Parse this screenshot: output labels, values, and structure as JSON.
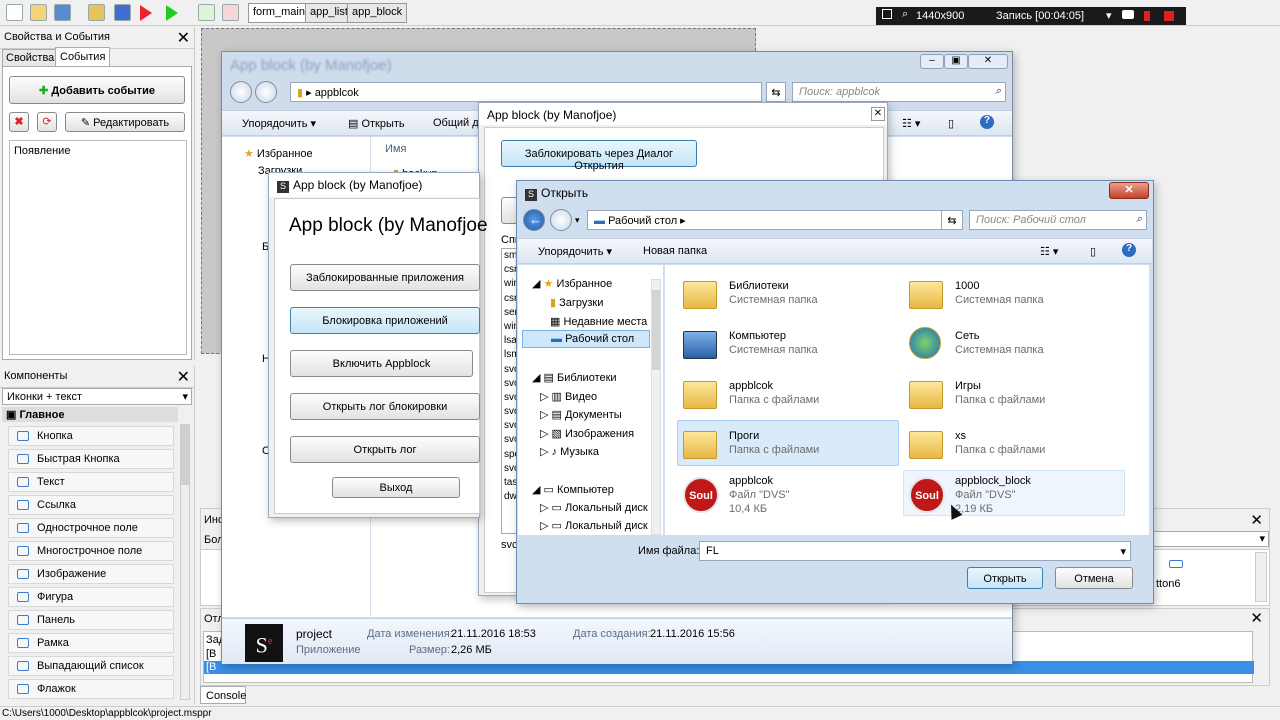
{
  "toolbar": {
    "tabs": [
      "form_main",
      "app_list",
      "app_block"
    ]
  },
  "recorder": {
    "resolution": "1440x900",
    "label": "Запись [00:04:05]"
  },
  "props": {
    "title": "Свойства и События",
    "tab_props": "Свойства",
    "tab_events": "События",
    "add_event": "Добавить событие",
    "edit": "Редактировать",
    "event_item": "Появление"
  },
  "components": {
    "title": "Компоненты",
    "view": "Иконки + текст",
    "group": "Главное",
    "items": [
      "Кнопка",
      "Быстрая Кнопка",
      "Текст",
      "Ссылка",
      "Однострочное поле",
      "Многострочное поле",
      "Изображение",
      "Фигура",
      "Панель",
      "Рамка",
      "Выпадающий список",
      "Флажок"
    ]
  },
  "statusbar": {
    "path": "C:\\Users\\1000\\Desktop\\appblcok\\project.msppr",
    "console_tab": "Console"
  },
  "bottom_panels": {
    "frag1": "Инс",
    "frag2": "Бол",
    "frag3": "Отл",
    "frag4": "Зад",
    "frag5": "[В",
    "frag6": "[В",
    "button6": "tton6"
  },
  "explorer_bg": {
    "title": "App block (by Manofjoe)",
    "address": "appblcok",
    "search": "Поиск: appblcok",
    "organize": "Упорядочить",
    "open": "Открыть",
    "share": "Общий д",
    "favorites": "Избранное",
    "downloads": "Загрузки",
    "name_col": "Имя",
    "file_name": "project",
    "file_type": "Приложение",
    "date_mod_label": "Дата изменения:",
    "date_mod": "21.11.2016 18:53",
    "date_created_label": "Дата создания:",
    "date_created": "21.11.2016 15:56",
    "size_label": "Размер:",
    "size": "2,26 МБ",
    "frag_b": "Б",
    "frag_n": "Н",
    "frag_s": "С",
    "frag_backup": "backup"
  },
  "app_win_mid": {
    "title": "App block (by Manofjoe)",
    "block_dialog": "Заблокировать через Диалог Открытия",
    "list_label": "Спи",
    "list": [
      "smss",
      "csrs",
      "wini",
      "csrs",
      "serv",
      "wini",
      "lsas",
      "lsm.",
      "svcl",
      "svcl",
      "svcl",
      "svcl",
      "svcl",
      "svcl",
      "spo",
      "svcl",
      "task",
      "dwn"
    ],
    "svch": "svch"
  },
  "app_win_front": {
    "title": "App block (by Manofjoe)",
    "heading": "App block (by Manofjoe",
    "btn1": "Заблокированные приложения",
    "btn2": "Блокировка приложений",
    "btn3": "Включить Appblock",
    "btn4": "Открыть лог блокировки",
    "btn5": "Открыть лог",
    "btn_exit": "Выход"
  },
  "open_dialog": {
    "title": "Открыть",
    "address": "Рабочий стол",
    "search": "Поиск: Рабочий стол",
    "organize": "Упорядочить",
    "new_folder": "Новая папка",
    "tree": {
      "favorites": "Избранное",
      "downloads": "Загрузки",
      "recent": "Недавние места",
      "desktop": "Рабочий стол",
      "libraries": "Библиотеки",
      "video": "Видео",
      "documents": "Документы",
      "images": "Изображения",
      "music": "Музыка",
      "computer": "Компьютер",
      "local1": "Локальный диск",
      "local2": "Локальный диск"
    },
    "files": [
      {
        "name": "Библиотеки",
        "sub": "Системная папка"
      },
      {
        "name": "1000",
        "sub": "Системная папка"
      },
      {
        "name": "Компьютер",
        "sub": "Системная папка"
      },
      {
        "name": "Сеть",
        "sub": "Системная папка"
      },
      {
        "name": "appblcok",
        "sub": "Папка с файлами"
      },
      {
        "name": "Игры",
        "sub": "Папка с файлами"
      },
      {
        "name": "Проги",
        "sub": "Папка с файлами"
      },
      {
        "name": "xs",
        "sub": "Папка с файлами"
      },
      {
        "name": "appblcok",
        "sub": "Файл \"DVS\"",
        "size": "10,4 КБ"
      },
      {
        "name": "appblock_block",
        "sub": "Файл \"DVS\"",
        "size": "2,19 КБ"
      }
    ],
    "filename_label": "Имя файла:",
    "filename_value": "FL",
    "open_btn": "Открыть",
    "cancel_btn": "Отмена",
    "soul": "Soul"
  }
}
